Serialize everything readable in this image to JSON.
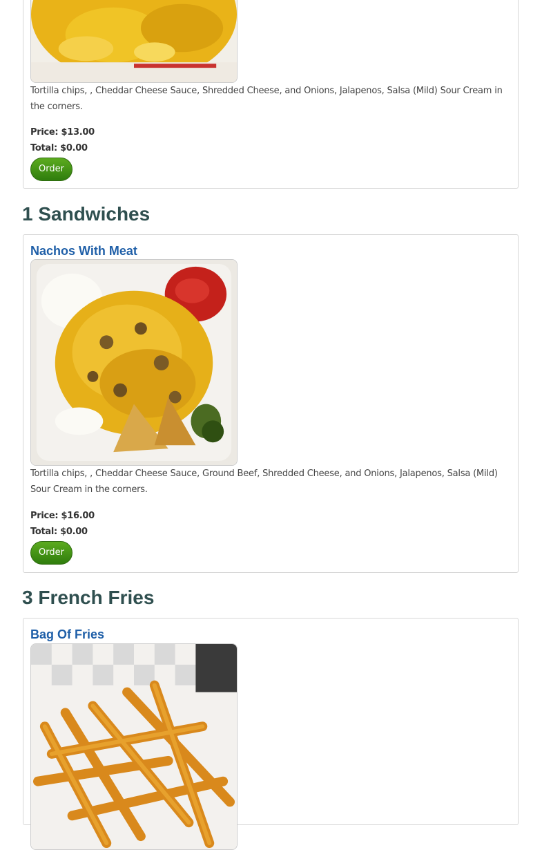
{
  "item_1": {
    "description": "Tortilla chips, , Cheddar Cheese Sauce, Shredded Cheese, and Onions, Jalapenos, Salsa (Mild) Sour Cream in the corners.",
    "price": "Price: $13.00",
    "total": "Total: $0.00",
    "order_label": "Order",
    "photo_icon": "nachos-cheese-photo"
  },
  "section_sandwiches": {
    "heading": "1 Sandwiches"
  },
  "item_2": {
    "title": "Nachos With Meat",
    "description": "Tortilla chips, , Cheddar Cheese Sauce, Ground Beef, Shredded Cheese, and Onions, Jalapenos, Salsa (Mild) Sour Cream in the corners.",
    "price": "Price: $16.00",
    "total": "Total: $0.00",
    "order_label": "Order",
    "photo_icon": "nachos-meat-photo"
  },
  "section_fries": {
    "heading": "3 French Fries"
  },
  "item_3": {
    "title": "Bag Of Fries",
    "photo_icon": "fries-photo"
  },
  "colors": {
    "title_blue": "#1f5fa8",
    "heading_slate": "#2f4f4f",
    "button_green": "#3f8f14"
  }
}
